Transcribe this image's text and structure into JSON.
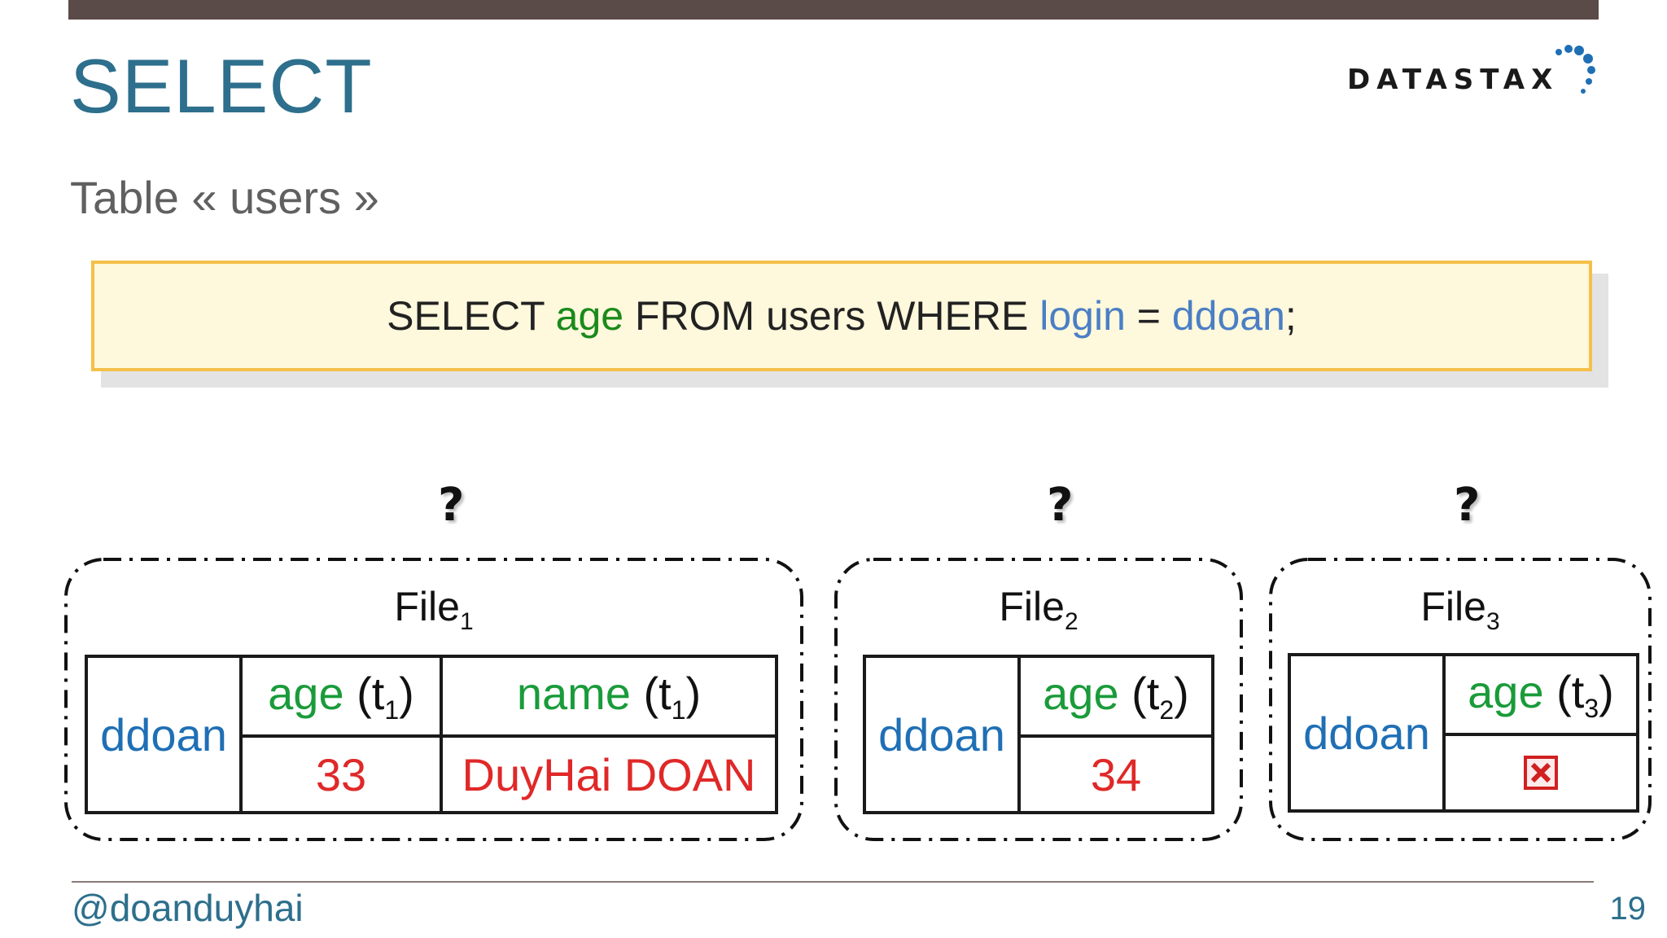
{
  "slide": {
    "title": "SELECT",
    "subtitle": "Table « users »",
    "logo_text": "DATASTAX",
    "handle": "@doanduyhai",
    "page_number": "19"
  },
  "query": {
    "p1": "SELECT ",
    "age": "age",
    "p2": " FROM users WHERE ",
    "login": "login",
    "p3": " = ",
    "value": "ddoan",
    "p4": ";"
  },
  "question_mark": "?",
  "files": [
    {
      "label": "File",
      "sub": "1",
      "key": "ddoan",
      "columns": [
        {
          "name": "age",
          "ts": "1",
          "value": "33"
        },
        {
          "name": "name",
          "ts": "1",
          "value": "DuyHai DOAN"
        }
      ]
    },
    {
      "label": "File",
      "sub": "2",
      "key": "ddoan",
      "columns": [
        {
          "name": "age",
          "ts": "2",
          "value": "34"
        }
      ]
    },
    {
      "label": "File",
      "sub": "3",
      "key": "ddoan",
      "columns": [
        {
          "name": "age",
          "ts": "3",
          "value_icon": "tombstone-x-icon"
        }
      ]
    }
  ],
  "colors": {
    "title": "#2d6f8c",
    "green": "#1a9b3a",
    "blue": "#1f6fb5",
    "red": "#e02828",
    "query_border": "#f4c04a",
    "query_bg": "#fef8dc"
  }
}
